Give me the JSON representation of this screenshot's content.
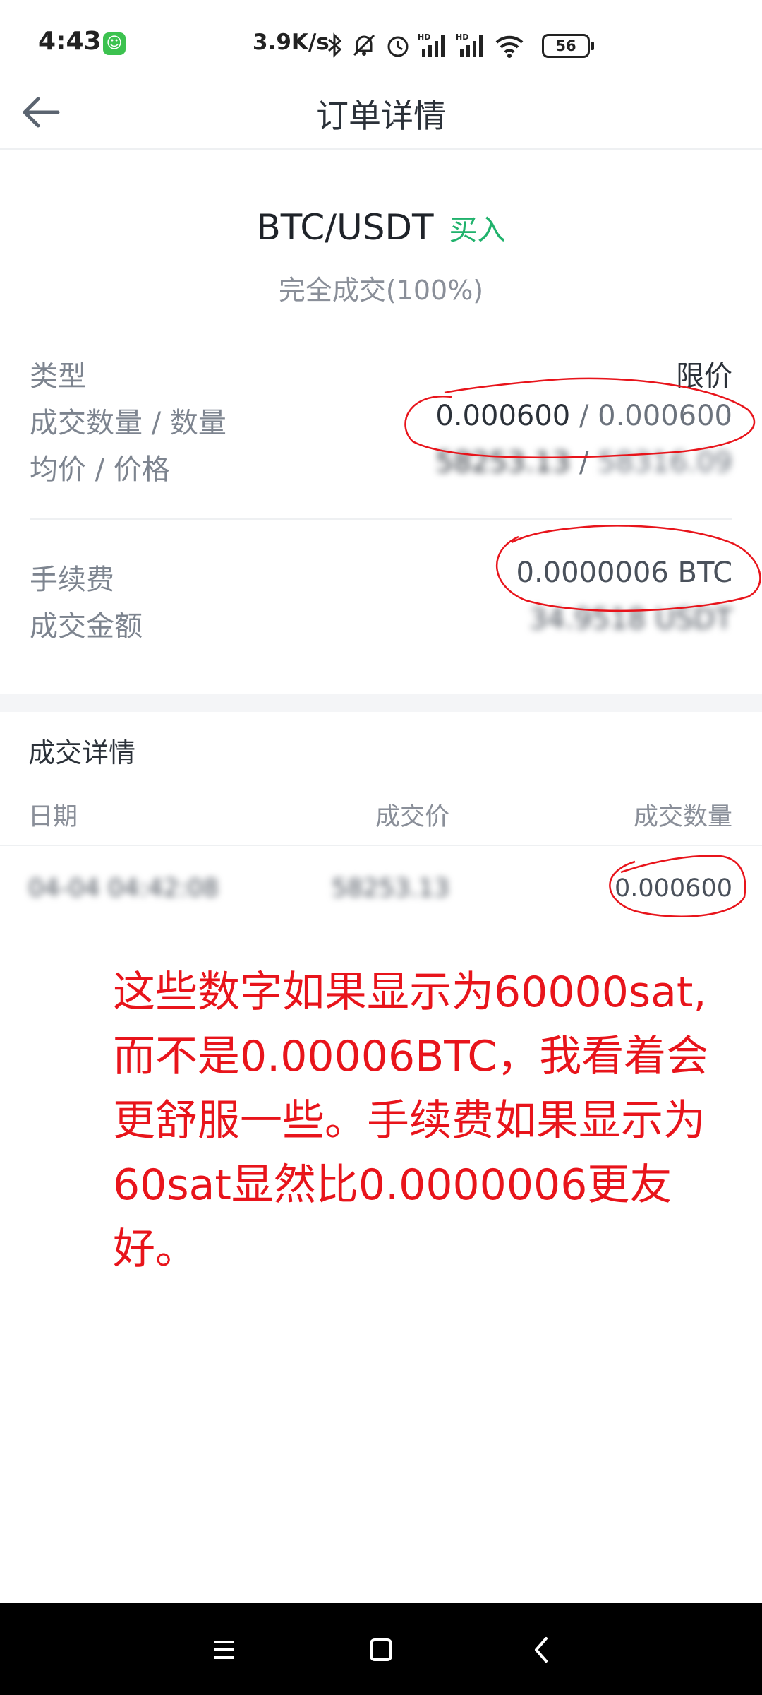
{
  "status_bar": {
    "time": "4:43",
    "net_speed": "3.9K/s",
    "battery": "56",
    "icons": [
      "bluetooth-icon",
      "mute-icon",
      "alarm-icon",
      "signal-hd-icon",
      "signal-hd-icon",
      "wifi-icon",
      "battery-icon"
    ]
  },
  "header": {
    "title": "订单详情",
    "back_icon": "arrow-left-icon"
  },
  "order": {
    "pair": "BTC/USDT",
    "side": "买入",
    "status": "完全成交(100%)",
    "rows": [
      {
        "label": "类型",
        "value": "限价"
      },
      {
        "label": "成交数量 / 数量",
        "value_a": "0.000600",
        "sep": " / ",
        "value_b": "0.000600"
      },
      {
        "label": "均价 / 价格",
        "value_a": "58253.13",
        "sep": " / ",
        "value_b": "58316.09"
      },
      {
        "label": "手续费",
        "value": "0.0000006 BTC"
      },
      {
        "label": "成交金额",
        "value": "34.9518 USDT"
      }
    ]
  },
  "trades": {
    "title": "成交详情",
    "columns": [
      "日期",
      "成交价",
      "成交数量"
    ],
    "rows": [
      {
        "date": "04-04 04:42:08",
        "price": "58253.13",
        "amount": "0.000600"
      }
    ]
  },
  "annotation_note": "这些数字如果显示为60000sat,而不是0.00006BTC，我看着会更舒服一些。手续费如果显示为60sat显然比0.0000006更友好。",
  "colors": {
    "buy_green": "#20b26c",
    "annotation_red": "#e8141b",
    "label_gray": "#7d848f"
  }
}
